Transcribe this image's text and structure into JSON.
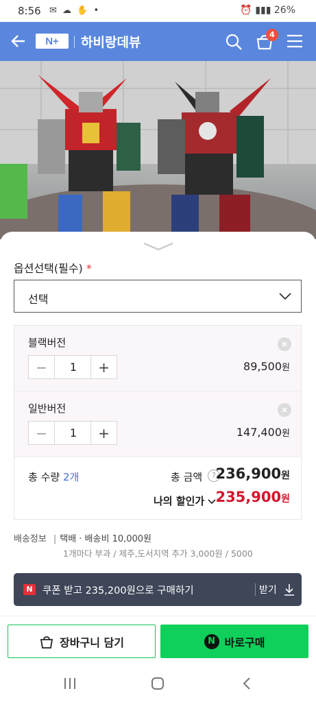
{
  "status_bar": {
    "time": "8:56",
    "battery": "26%"
  },
  "header": {
    "store_name": "하비랑데뷰",
    "logo_text": "N+",
    "cart_count": "4"
  },
  "options": {
    "label": "옵션선택(필수)",
    "required_mark": "*",
    "select_value": "선택",
    "items": [
      {
        "name": "블랙버전",
        "quantity": "1",
        "price": "89,500",
        "unit": "원"
      },
      {
        "name": "일반버전",
        "quantity": "1",
        "price": "147,400",
        "unit": "원"
      }
    ]
  },
  "totals": {
    "quantity_label": "총 수량",
    "quantity": "2개",
    "amount_label": "총 금액",
    "help": "?",
    "amount": "236,900",
    "unit": "원",
    "discount_label": "나의 할인가",
    "discount_price": "235,900"
  },
  "shipping": {
    "label": "배송정보",
    "method": "택배 · 배송비 10,000원",
    "note": "1개마다 부과 / 제주,도서지역 추가 3,000원 / 5000"
  },
  "coupon": {
    "badge": "N",
    "text": "쿠폰 받고 235,200원으로 구매하기",
    "get_label": "받기"
  },
  "actions": {
    "cart_label": "장바구니 담기",
    "buy_label": "바로구매",
    "buy_badge": "N"
  },
  "colors": {
    "header_bg": "#5a87dd",
    "buy_green": "#0fd05a",
    "discount_red": "#d4162c",
    "coupon_bg": "#3e4658"
  }
}
